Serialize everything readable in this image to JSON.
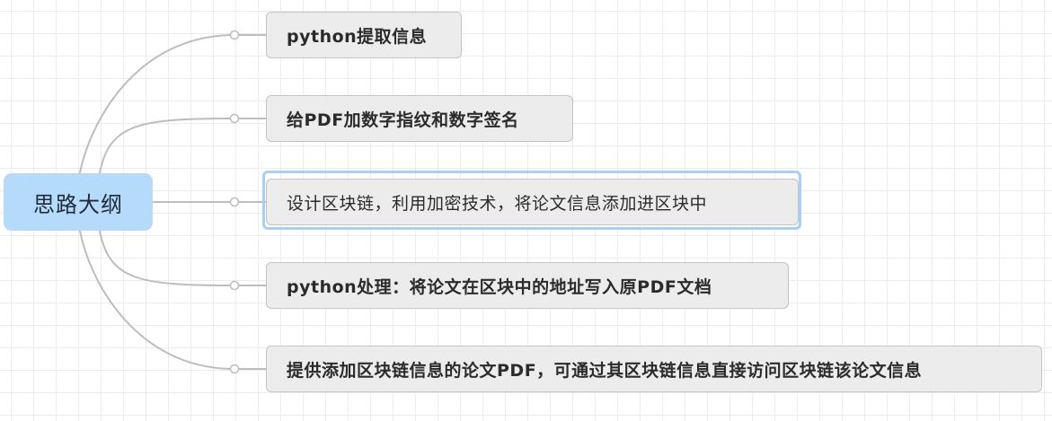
{
  "root": {
    "label": "思路大纲"
  },
  "branches": [
    {
      "label": "python提取信息"
    },
    {
      "label": "给PDF加数字指纹和数字签名"
    },
    {
      "label": "设计区块链，利用加密技术，将论文信息添加进区块中",
      "selected": true
    },
    {
      "label": "python处理：将论文在区块中的地址写入原PDF文档"
    },
    {
      "label": "提供添加区块链信息的论文PDF，可通过其区块链信息直接访问区块链该论文信息"
    }
  ],
  "colors": {
    "root_fill": "#b6daf9",
    "topic_fill": "#ececec",
    "topic_border": "#c4c4c4",
    "connector": "#bdbdbd",
    "selection": "#a9cff4"
  }
}
